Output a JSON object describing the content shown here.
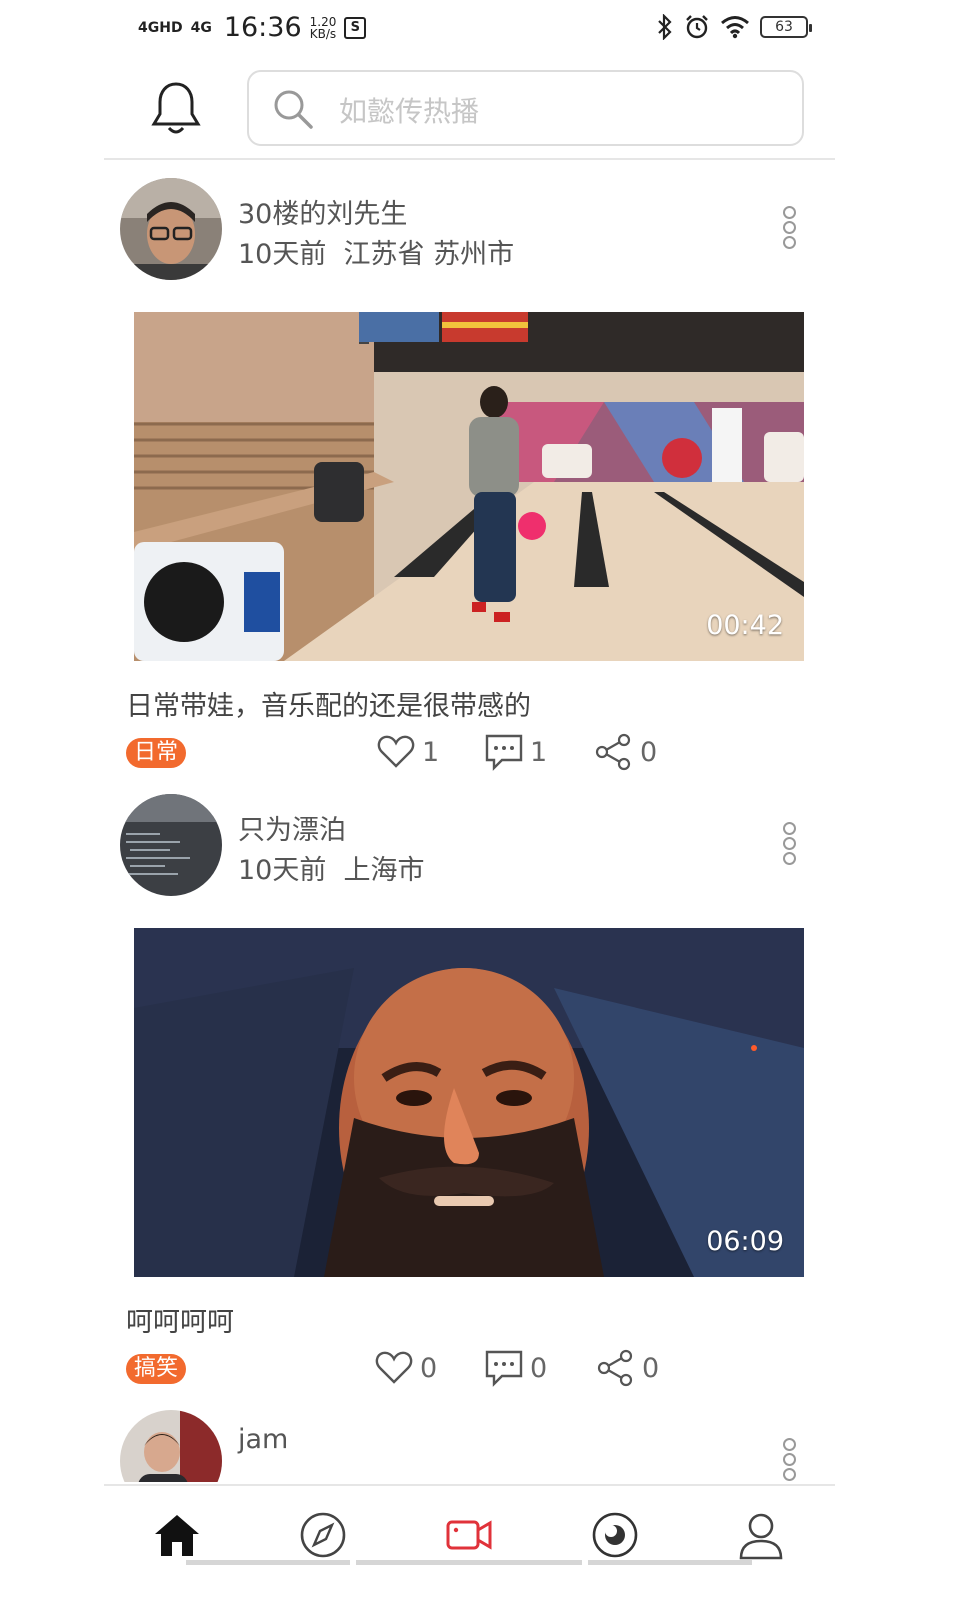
{
  "status_bar": {
    "net1": "4GHD",
    "net2": "4G",
    "time": "16:36",
    "speed_value": "1.20",
    "speed_unit": "KB/s",
    "badge": "S",
    "battery": "63"
  },
  "header": {
    "search_placeholder": "如懿传热播"
  },
  "posts": [
    {
      "username": "30楼的刘先生",
      "meta": "10天前  江苏省 苏州市",
      "duration": "00:42",
      "caption": "日常带娃，音乐配的还是很带感的",
      "tag": "日常",
      "likes": "1",
      "comments": "1",
      "shares": "0"
    },
    {
      "username": "只为漂泊",
      "meta": "10天前  上海市",
      "duration": "06:09",
      "caption": "呵呵呵呵",
      "tag": "搞笑",
      "likes": "0",
      "comments": "0",
      "shares": "0"
    },
    {
      "username": "jam"
    }
  ],
  "colors": {
    "accent": "#f26a2e",
    "active_tab": "#e0323a"
  },
  "tabs": [
    {
      "icon": "home-icon",
      "active": false
    },
    {
      "icon": "compass-icon",
      "active": false
    },
    {
      "icon": "video-camera-icon",
      "active": true
    },
    {
      "icon": "eye-icon",
      "active": false
    },
    {
      "icon": "user-icon",
      "active": false
    }
  ]
}
